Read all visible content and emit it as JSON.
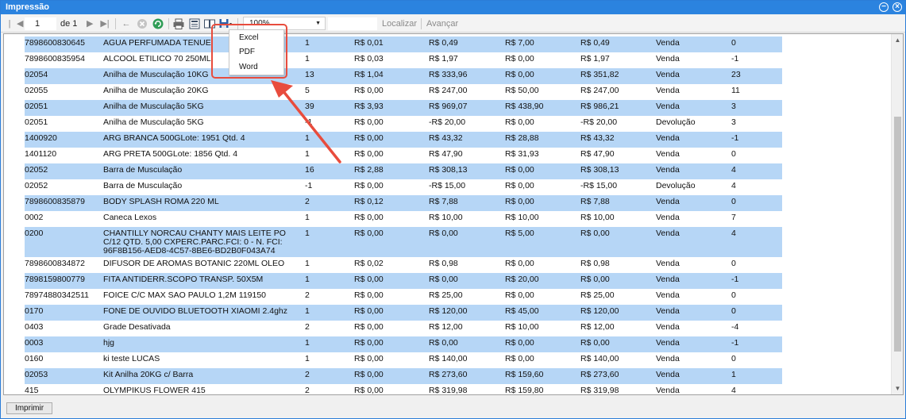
{
  "window": {
    "title": "Impressão"
  },
  "toolbar": {
    "page_value": "1",
    "page_of_label": "de 1",
    "zoom": "100%",
    "find_label": "Localizar",
    "next_label": "Avançar"
  },
  "export_menu": {
    "items": [
      "Excel",
      "PDF",
      "Word"
    ]
  },
  "rows": [
    {
      "code": "7898600830645",
      "desc": "AGUA PERFUMADA TENUE",
      "qty": "1",
      "v1": "R$ 0,01",
      "v2": "R$ 0,49",
      "v3": "R$ 7,00",
      "v4": "R$ 0,49",
      "type": "Venda",
      "n": "0"
    },
    {
      "code": "7898600835954",
      "desc": "ALCOOL ETILICO 70 250ML",
      "qty": "1",
      "v1": "R$ 0,03",
      "v2": "R$ 1,97",
      "v3": "R$ 0,00",
      "v4": "R$ 1,97",
      "type": "Venda",
      "n": "-1"
    },
    {
      "code": "02054",
      "desc": "Anilha de Musculação 10KG",
      "qty": "13",
      "v1": "R$ 1,04",
      "v2": "R$ 333,96",
      "v3": "R$ 0,00",
      "v4": "R$ 351,82",
      "type": "Venda",
      "n": "23"
    },
    {
      "code": "02055",
      "desc": "Anilha de Musculação 20KG",
      "qty": "5",
      "v1": "R$ 0,00",
      "v2": "R$ 247,00",
      "v3": "R$ 50,00",
      "v4": "R$ 247,00",
      "type": "Venda",
      "n": "11"
    },
    {
      "code": "02051",
      "desc": "Anilha de Musculação 5KG",
      "qty": "39",
      "v1": "R$ 3,93",
      "v2": "R$ 969,07",
      "v3": "R$ 438,90",
      "v4": "R$ 986,21",
      "type": "Venda",
      "n": "3"
    },
    {
      "code": "02051",
      "desc": "Anilha de Musculação 5KG",
      "qty": "-1",
      "v1": "R$ 0,00",
      "v2": "-R$ 20,00",
      "v3": "R$ 0,00",
      "v4": "-R$ 20,00",
      "type": "Devolução",
      "n": "3"
    },
    {
      "code": "1400920",
      "desc": "ARG BRANCA 500GLote: 1951 Qtd. 4",
      "qty": "1",
      "v1": "R$ 0,00",
      "v2": "R$ 43,32",
      "v3": "R$ 28,88",
      "v4": "R$ 43,32",
      "type": "Venda",
      "n": "-1"
    },
    {
      "code": "1401120",
      "desc": "ARG PRETA 500GLote: 1856 Qtd. 4",
      "qty": "1",
      "v1": "R$ 0,00",
      "v2": "R$ 47,90",
      "v3": "R$ 31,93",
      "v4": "R$ 47,90",
      "type": "Venda",
      "n": "0"
    },
    {
      "code": "02052",
      "desc": "Barra de Musculação",
      "qty": "16",
      "v1": "R$ 2,88",
      "v2": "R$ 308,13",
      "v3": "R$ 0,00",
      "v4": "R$ 308,13",
      "type": "Venda",
      "n": "4"
    },
    {
      "code": "02052",
      "desc": "Barra de Musculação",
      "qty": "-1",
      "v1": "R$ 0,00",
      "v2": "-R$ 15,00",
      "v3": "R$ 0,00",
      "v4": "-R$ 15,00",
      "type": "Devolução",
      "n": "4"
    },
    {
      "code": "7898600835879",
      "desc": "BODY SPLASH ROMA 220 ML",
      "qty": "2",
      "v1": "R$ 0,12",
      "v2": "R$ 7,88",
      "v3": "R$ 0,00",
      "v4": "R$ 7,88",
      "type": "Venda",
      "n": "0"
    },
    {
      "code": "0002",
      "desc": "Caneca Lexos",
      "qty": "1",
      "v1": "R$ 0,00",
      "v2": "R$ 10,00",
      "v3": "R$ 10,00",
      "v4": "R$ 10,00",
      "type": "Venda",
      "n": "7"
    },
    {
      "code": "0200",
      "desc": "CHANTILLY NORCAU CHANTY MAIS LEITE PO C/12 QTD. 5,00 CXPERC.PARC.FCI: 0 - N. FCI: 96F8B156-AED8-4C57-8BE6-BD2B0F043A74",
      "qty": "1",
      "v1": "R$ 0,00",
      "v2": "R$ 0,00",
      "v3": "R$ 5,00",
      "v4": "R$ 0,00",
      "type": "Venda",
      "n": "4"
    },
    {
      "code": "7898600834872",
      "desc": "DIFUSOR DE AROMAS BOTANIC 220ML OLEO",
      "qty": "1",
      "v1": "R$ 0,02",
      "v2": "R$ 0,98",
      "v3": "R$ 0,00",
      "v4": "R$ 0,98",
      "type": "Venda",
      "n": "0"
    },
    {
      "code": "7898159800779",
      "desc": "FITA ANTIDERR.SCOPO TRANSP. 50X5M",
      "qty": "1",
      "v1": "R$ 0,00",
      "v2": "R$ 0,00",
      "v3": "R$ 20,00",
      "v4": "R$ 0,00",
      "type": "Venda",
      "n": "-1"
    },
    {
      "code": "78974880342511",
      "desc": "FOICE C/C MAX SAO PAULO 1,2M 119150",
      "qty": "2",
      "v1": "R$ 0,00",
      "v2": "R$ 25,00",
      "v3": "R$ 0,00",
      "v4": "R$ 25,00",
      "type": "Venda",
      "n": "0"
    },
    {
      "code": "0170",
      "desc": "FONE DE OUVIDO BLUETOOTH XIAOMI 2.4ghz",
      "qty": "1",
      "v1": "R$ 0,00",
      "v2": "R$ 120,00",
      "v3": "R$ 45,00",
      "v4": "R$ 120,00",
      "type": "Venda",
      "n": "0"
    },
    {
      "code": "0403",
      "desc": "Grade Desativada",
      "qty": "2",
      "v1": "R$ 0,00",
      "v2": "R$ 12,00",
      "v3": "R$ 10,00",
      "v4": "R$ 12,00",
      "type": "Venda",
      "n": "-4"
    },
    {
      "code": "0003",
      "desc": "hjg",
      "qty": "1",
      "v1": "R$ 0,00",
      "v2": "R$ 0,00",
      "v3": "R$ 0,00",
      "v4": "R$ 0,00",
      "type": "Venda",
      "n": "-1"
    },
    {
      "code": "0160",
      "desc": "ki teste LUCAS",
      "qty": "1",
      "v1": "R$ 0,00",
      "v2": "R$ 140,00",
      "v3": "R$ 0,00",
      "v4": "R$ 140,00",
      "type": "Venda",
      "n": "0"
    },
    {
      "code": "02053",
      "desc": "Kit Anilha 20KG c/ Barra",
      "qty": "2",
      "v1": "R$ 0,00",
      "v2": "R$ 273,60",
      "v3": "R$ 159,60",
      "v4": "R$ 273,60",
      "type": "Venda",
      "n": "1"
    },
    {
      "code": "415",
      "desc": "OLYMPIKUS FLOWER 415",
      "qty": "2",
      "v1": "R$ 0,00",
      "v2": "R$ 319,98",
      "v3": "R$ 159,80",
      "v4": "R$ 319,98",
      "type": "Venda",
      "n": "4"
    }
  ],
  "footer": {
    "print_label": "Imprimir"
  },
  "colors": {
    "title_bar": "#2b83df",
    "row_alt": "#b6d6f6",
    "annotation": "#e84c3d"
  }
}
